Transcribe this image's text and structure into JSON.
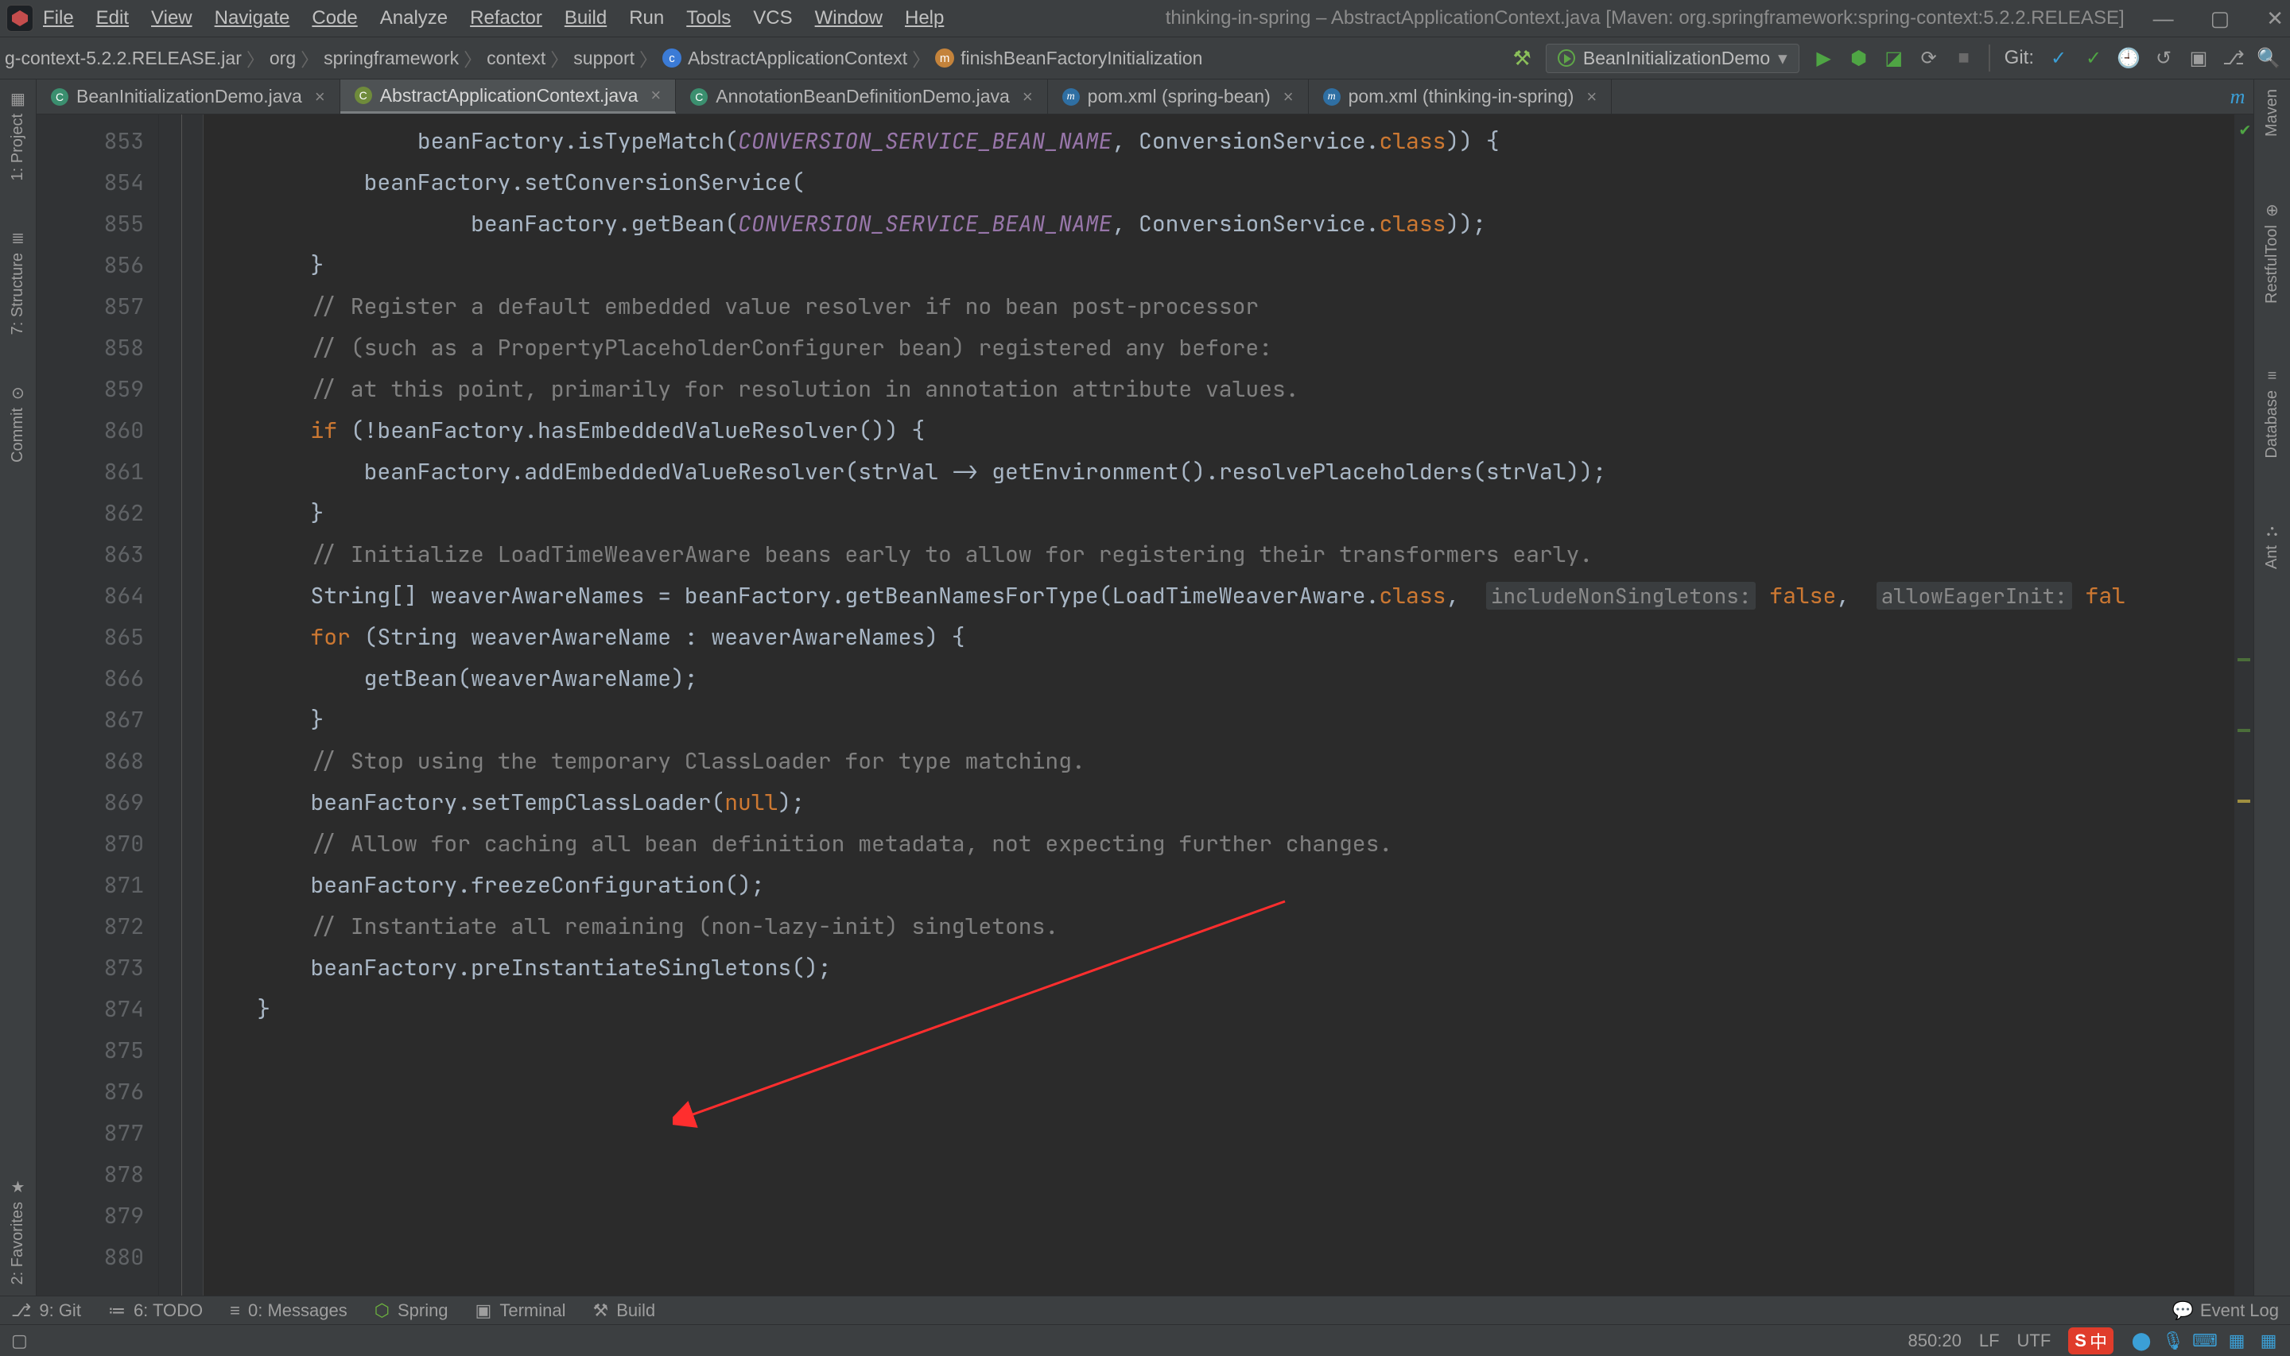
{
  "menu": {
    "file": "File",
    "edit": "Edit",
    "view": "View",
    "navigate": "Navigate",
    "code": "Code",
    "analyze": "Analyze",
    "refactor": "Refactor",
    "build": "Build",
    "run": "Run",
    "tools": "Tools",
    "vcs": "VCS",
    "window": "Window",
    "help": "Help"
  },
  "window_title": "thinking-in-spring – AbstractApplicationContext.java [Maven: org.springframework:spring-context:5.2.2.RELEASE]",
  "breadcrumbs": {
    "jar": "g-context-5.2.2.RELEASE.jar",
    "org": "org",
    "sf": "springframework",
    "ctx": "context",
    "sup": "support",
    "cls": "AbstractApplicationContext",
    "mth": "finishBeanFactoryInitialization"
  },
  "run_config": "BeanInitializationDemo",
  "git_label": "Git:",
  "tabs": [
    {
      "name": "BeanInitializationDemo.java",
      "icon": "c"
    },
    {
      "name": "AbstractApplicationContext.java",
      "icon": "co",
      "active": true
    },
    {
      "name": "AnnotationBeanDefinitionDemo.java",
      "icon": "c"
    },
    {
      "name": "pom.xml (spring-bean)",
      "icon": "m"
    },
    {
      "name": "pom.xml (thinking-in-spring)",
      "icon": "m"
    }
  ],
  "rightlogo": "m",
  "lines": [
    853,
    854,
    855,
    856,
    857,
    858,
    859,
    860,
    861,
    862,
    863,
    864,
    865,
    866,
    867,
    868,
    869,
    870,
    871,
    872,
    873,
    874,
    875,
    876,
    877,
    878,
    879,
    880
  ],
  "code": [
    {
      "indent": 16,
      "frag": [
        {
          "t": "beanFactory.isTypeMatch("
        },
        {
          "t": "CONVERSION_SERVICE_BEAN_NAME",
          "c": "str"
        },
        {
          "t": ", ConversionService."
        },
        {
          "t": "class",
          "c": "cls"
        },
        {
          "t": ")) {"
        }
      ]
    },
    {
      "indent": 12,
      "frag": [
        {
          "t": "beanFactory.setConversionService("
        }
      ]
    },
    {
      "indent": 20,
      "frag": [
        {
          "t": "beanFactory.getBean("
        },
        {
          "t": "CONVERSION_SERVICE_BEAN_NAME",
          "c": "str"
        },
        {
          "t": ", ConversionService."
        },
        {
          "t": "class",
          "c": "cls"
        },
        {
          "t": "));"
        }
      ]
    },
    {
      "indent": 8,
      "frag": [
        {
          "t": "}"
        }
      ]
    },
    {
      "indent": 0,
      "frag": [
        {
          "t": ""
        }
      ]
    },
    {
      "indent": 8,
      "frag": [
        {
          "t": "// Register a default embedded value resolver if no bean post-processor",
          "c": "cm"
        }
      ]
    },
    {
      "indent": 8,
      "frag": [
        {
          "t": "// (such as a PropertyPlaceholderConfigurer bean) registered any before:",
          "c": "cm"
        }
      ]
    },
    {
      "indent": 8,
      "frag": [
        {
          "t": "// at this point, primarily for resolution in annotation attribute values.",
          "c": "cm"
        }
      ]
    },
    {
      "indent": 8,
      "frag": [
        {
          "t": "if ",
          "c": "kw"
        },
        {
          "t": "(!beanFactory.hasEmbeddedValueResolver()) {"
        }
      ]
    },
    {
      "indent": 12,
      "frag": [
        {
          "t": "beanFactory.addEmbeddedValueResolver(strVal -> getEnvironment().resolvePlaceholders(strVal));"
        }
      ]
    },
    {
      "indent": 8,
      "frag": [
        {
          "t": "}"
        }
      ]
    },
    {
      "indent": 0,
      "frag": [
        {
          "t": ""
        }
      ]
    },
    {
      "indent": 8,
      "frag": [
        {
          "t": "// Initialize LoadTimeWeaverAware beans early to allow for registering their transformers early.",
          "c": "cm"
        }
      ]
    },
    {
      "indent": 8,
      "frag": [
        {
          "t": "String[] weaverAwareNames = beanFactory.getBeanNamesForType(LoadTimeWeaverAware."
        },
        {
          "t": "class",
          "c": "cls"
        },
        {
          "t": ",  "
        },
        {
          "t": "includeNonSingletons:",
          "c": "hint"
        },
        {
          "t": " "
        },
        {
          "t": "false",
          "c": "kw"
        },
        {
          "t": ",  "
        },
        {
          "t": "allowEagerInit:",
          "c": "hint"
        },
        {
          "t": " "
        },
        {
          "t": "fal",
          "c": "kw"
        }
      ]
    },
    {
      "indent": 8,
      "frag": [
        {
          "t": "for ",
          "c": "kw"
        },
        {
          "t": "(String weaverAwareName : weaverAwareNames) {"
        }
      ]
    },
    {
      "indent": 12,
      "frag": [
        {
          "t": "getBean(weaverAwareName);"
        }
      ]
    },
    {
      "indent": 8,
      "frag": [
        {
          "t": "}"
        }
      ]
    },
    {
      "indent": 0,
      "frag": [
        {
          "t": ""
        }
      ]
    },
    {
      "indent": 8,
      "frag": [
        {
          "t": "// Stop using the temporary ClassLoader for type matching.",
          "c": "cm"
        }
      ]
    },
    {
      "indent": 8,
      "frag": [
        {
          "t": "beanFactory.setTempClassLoader("
        },
        {
          "t": "null",
          "c": "kw"
        },
        {
          "t": ");"
        }
      ]
    },
    {
      "indent": 0,
      "frag": [
        {
          "t": ""
        }
      ]
    },
    {
      "indent": 8,
      "frag": [
        {
          "t": "// Allow for caching all bean definition metadata, not expecting further changes.",
          "c": "cm"
        }
      ]
    },
    {
      "indent": 8,
      "frag": [
        {
          "t": "beanFactory.freezeConfiguration();"
        }
      ]
    },
    {
      "indent": 0,
      "frag": [
        {
          "t": ""
        }
      ]
    },
    {
      "indent": 8,
      "frag": [
        {
          "t": "// Instantiate all remaining (non-lazy-init) singletons.",
          "c": "cm"
        }
      ]
    },
    {
      "indent": 8,
      "frag": [
        {
          "t": "beanFactory.preInstantiateSingletons();"
        }
      ]
    },
    {
      "indent": 4,
      "frag": [
        {
          "t": "}"
        }
      ]
    },
    {
      "indent": 0,
      "frag": [
        {
          "t": ""
        }
      ]
    }
  ],
  "leftrail": {
    "project": "1: Project",
    "structure": "7: Structure",
    "commit": "Commit",
    "favorites": "2: Favorites"
  },
  "rightrail": {
    "maven": "Maven",
    "restful": "RestfulTool",
    "database": "Database",
    "ant": "Ant"
  },
  "bottombar": {
    "git": "9: Git",
    "todo": "6: TODO",
    "messages": "0: Messages",
    "spring": "Spring",
    "terminal": "Terminal",
    "build": "Build",
    "eventlog": "Event Log"
  },
  "status": {
    "pos": "850:20",
    "lf": "LF",
    "encoding": "UTF",
    "ime": "中",
    "ime_icon": "S"
  }
}
